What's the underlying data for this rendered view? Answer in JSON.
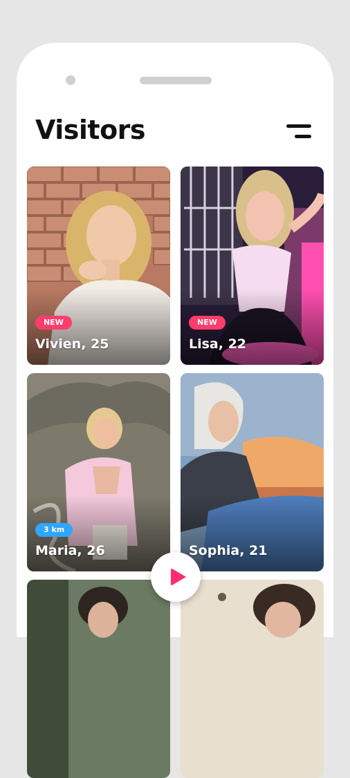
{
  "header": {
    "title": "Visitors"
  },
  "icons": {
    "menu": "menu-icon",
    "play": "play-icon"
  },
  "colors": {
    "new_badge": "#ff3d6c",
    "distance_badge": "#2fa6ff",
    "accent": "#ff2d6c"
  },
  "visitors": [
    {
      "name": "Vivien, 25",
      "badge": "NEW"
    },
    {
      "name": "Lisa, 22",
      "badge": "NEW"
    },
    {
      "name": "Maria, 26",
      "badge": "3 km"
    },
    {
      "name": "Sophia, 21",
      "badge": ""
    },
    {
      "name": "",
      "badge": ""
    },
    {
      "name": "",
      "badge": ""
    }
  ]
}
